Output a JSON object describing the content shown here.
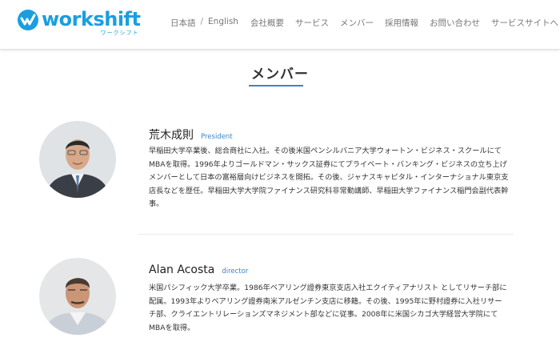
{
  "header": {
    "logo_text": "workshift",
    "logo_sub": "ワークシフト",
    "lang_ja": "日本語",
    "lang_sep": "/",
    "lang_en": "English",
    "nav": [
      {
        "label": "会社概要"
      },
      {
        "label": "サービス"
      },
      {
        "label": "メンバー"
      },
      {
        "label": "採用情報"
      },
      {
        "label": "お問い合わせ"
      },
      {
        "label": "サービスサイトへ"
      }
    ],
    "brand_color": "#1a9ee0"
  },
  "page": {
    "title": "メンバー",
    "accent_color": "#3a86c8"
  },
  "members": [
    {
      "name": "荒木成則",
      "role": "President",
      "bio": "早稲田大学卒業後、総合商社に入社。その後米国ペンシルバニア大学ウォートン・ビジネス・スクールにてMBAを取得。1996年よりゴールドマン・サックス証券にてプライベート・バンキング・ビジネスの立ち上げメンバーとして日本の富裕層向けビジネスを開拓。その後、ジャナスキャピタル・インターナショナル東京支店長などを歴任。早稲田大学大学院ファイナンス研究科非常勤講師、早稲田大学ファイナンス稲門会副代表幹事。"
    },
    {
      "name": "Alan Acosta",
      "role": "director",
      "bio": "米国パシフィック大学卒業。1986年ベアリング證券東京支店入社エクイティアナリスト としてリサーチ部に配属。1993年よりベアリング證券南米アルゼンチン支店に移籍。その後、1995年に野村證券に入社リサーチ部、クライエントリレーションズマネジメント部などに従事。2008年に米国シカゴ大学経営大学院にてMBAを取得。"
    }
  ]
}
